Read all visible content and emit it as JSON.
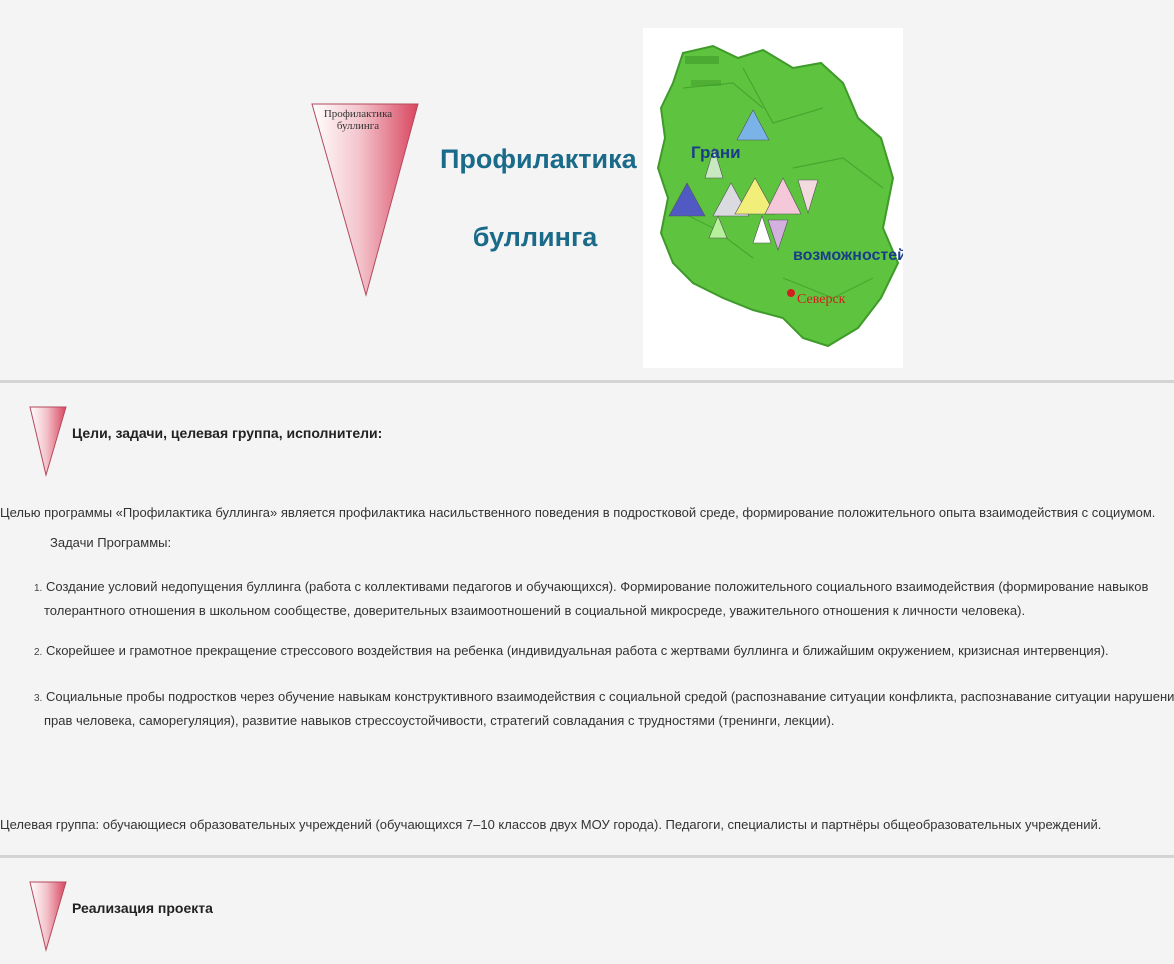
{
  "header": {
    "logo_text_line1": "Профилактика",
    "logo_text_line2": "буллинга",
    "title_line1": "Профилактика",
    "title_line2": "буллинга",
    "map": {
      "label_top": "Грани",
      "label_bottom": "возможностей",
      "city": "Северск",
      "colors": {
        "map_green": "#5ec43f",
        "map_dark": "#3f9a2a",
        "city": "#d21e1e",
        "label": "#1a3d8a"
      }
    }
  },
  "section1": {
    "title": "Цели, задачи, целевая группа, исполнители:",
    "goal": "Целью программы «Профилактика буллинга» является профилактика насильственного поведения в подростковой среде, формирование положительного опыта взаимодействия с социумом.",
    "tasks_heading": "Задачи Программы:",
    "tasks": [
      {
        "num": "1.",
        "line1": "Создание условий недопущения буллинга (работа с коллективами педагогов и обучающихся). Формирование положительного социального взаимодействия (формирование навыков",
        "line2": "толерантного отношения в школьном сообществе, доверительных взаимоотношений в социальной микросреде, уважительного отношения к личности человека)."
      },
      {
        "num": "2.",
        "line1": "Скорейшее и грамотное прекращение стрессового воздействия на ребенка (индивидуальная работа с жертвами буллинга и ближайшим окружением, кризисная интервенция).",
        "line2": ""
      },
      {
        "num": "3.",
        "line1": "Социальные пробы подростков через обучение навыкам конструктивного взаимодействия с социальной средой (распознавание ситуации конфликта, распознавание ситуации нарушени",
        "line2": "прав человека, саморегуляция), развитие навыков стрессоустойчивости, стратегий совладания с трудностями (тренинги, лекции)."
      }
    ],
    "target_group": "Целевая группа: обучающиеся образовательных учреждений (обучающихся 7–10 классов двух МОУ города). Педагоги, специалисты и партнёры общеобразовательных учреждений."
  },
  "section2": {
    "title": "Реализация проекта"
  },
  "colors": {
    "accent_pink": "#e87d8c",
    "title_blue": "#1a6a8a",
    "divider": "#d4d4d4"
  }
}
